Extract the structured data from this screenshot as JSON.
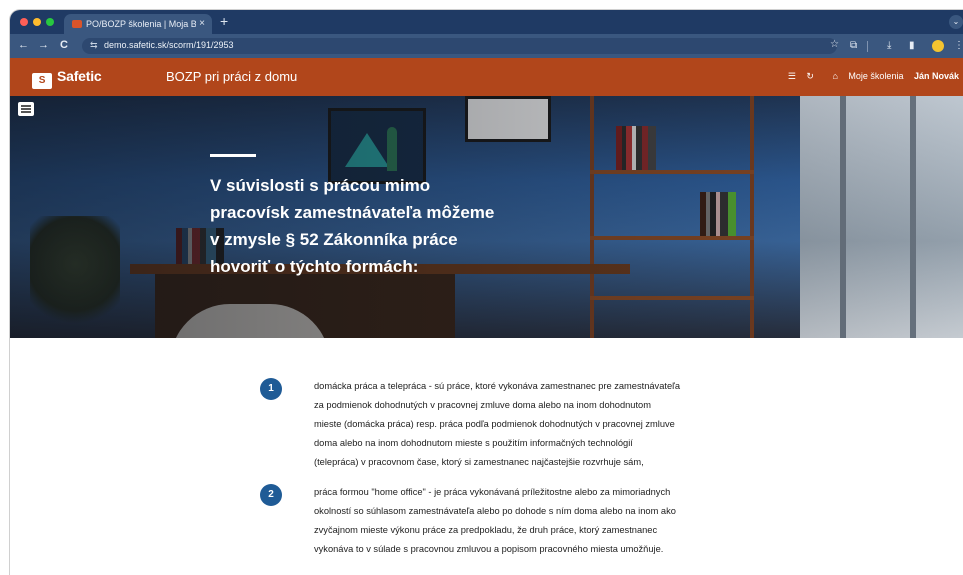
{
  "browser": {
    "tab_title": "PO/BOZP školenia | Moja BOZ",
    "tab_close": "×",
    "new_tab": "+",
    "tab_menu": "⌄",
    "site_icon": "⇆",
    "url": "demo.safetic.sk/scorm/191/2953",
    "bookmark_icon": "☆",
    "nav": {
      "back": "←",
      "forward": "→",
      "reload": "C"
    },
    "toolbar_icons": {
      "extensions": "⧉",
      "download": "⤓",
      "sidepanel": "▮",
      "more": "⋮"
    }
  },
  "app": {
    "brand": "Safetic",
    "brand_mark": "S",
    "course_title": "BOZP pri práci z domu",
    "menu_glyph": "☰",
    "refresh_glyph": "↻",
    "home_glyph": "⌂",
    "home_label": "Moje školenia",
    "user_name": "Ján Novák"
  },
  "hero": {
    "headline_lines": [
      "V súvislosti s prácou mimo",
      "pracovísk zamestnávateľa môžeme",
      "v zmysle § 52 Zákonníka práce",
      "hovoriť o týchto formách:"
    ]
  },
  "items": [
    {
      "number": "1",
      "lines": [
        "domácka práca a telepráca - sú práce, ktoré vykonáva zamestnanec pre zamestnávateľa",
        "za podmienok dohodnutých v pracovnej zmluve doma alebo na inom dohodnutom",
        "mieste (domácka práca) resp. práca podľa podmienok dohodnutých v pracovnej zmluve",
        "doma alebo na inom dohodnutom mieste s použitím informačných technológií",
        "(telepráca) v pracovnom čase, ktorý si zamestnanec najčastejšie rozvrhuje sám,"
      ]
    },
    {
      "number": "2",
      "lines": [
        "práca formou \"home office\" - je práca vykonávaná príležitostne alebo za mimoriadnych",
        "okolností so súhlasom zamestnávateľa alebo po dohode s ním doma alebo na inom ako",
        "zvyčajnom mieste výkonu práce za predpokladu, že druh práce, ktorý zamestnanec",
        "vykonáva to v súlade s pracovnou zmluvou a popisom pracovného miesta umožňuje."
      ]
    }
  ],
  "colors": {
    "app_bar": "#b1461b",
    "badge": "#1f5b96",
    "chrome": "#1f3a64"
  }
}
